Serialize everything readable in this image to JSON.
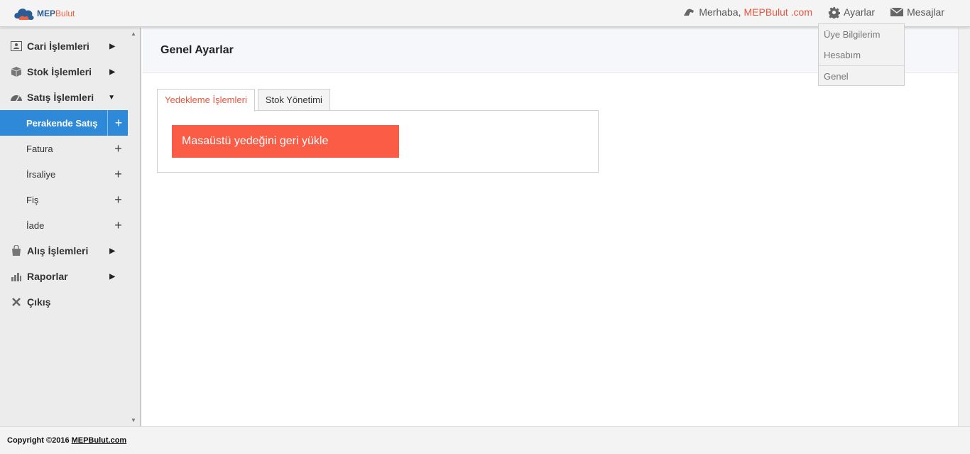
{
  "brand": {
    "part1": "MEP",
    "part2": "Bulut"
  },
  "topbar": {
    "greeting": "Merhaba,",
    "user_name": "MEPBulut .com",
    "settings_label": "Ayarlar",
    "messages_label": "Mesajlar"
  },
  "dropdown": {
    "items": [
      "Üye Bilgilerim",
      "Hesabım",
      "Genel"
    ]
  },
  "sidebar": {
    "items": [
      {
        "label": "Cari İşlemleri",
        "icon": "contact-card-icon"
      },
      {
        "label": "Stok İşlemleri",
        "icon": "box-icon"
      },
      {
        "label": "Satış İşlemleri",
        "icon": "dashboard-icon"
      },
      {
        "label": "Alış İşlemleri",
        "icon": "shopping-bag-icon"
      },
      {
        "label": "Raporlar",
        "icon": "bar-chart-icon"
      },
      {
        "label": "Çıkış",
        "icon": "close-icon"
      }
    ],
    "sub_items": [
      "Perakende Satış",
      "Fatura",
      "İrsaliye",
      "Fiş",
      "İade"
    ]
  },
  "page": {
    "title": "Genel Ayarlar",
    "tabs": [
      "Yedekleme İşlemleri",
      "Stok Yönetimi"
    ],
    "restore_button": "Masaüstü yedeğini geri yükle"
  },
  "footer": {
    "text": "Copyright ©2016",
    "link": "MEPBulut.com"
  },
  "colors": {
    "accent": "#fb5c46",
    "active": "#2e8ad8",
    "link": "#e8553e"
  }
}
